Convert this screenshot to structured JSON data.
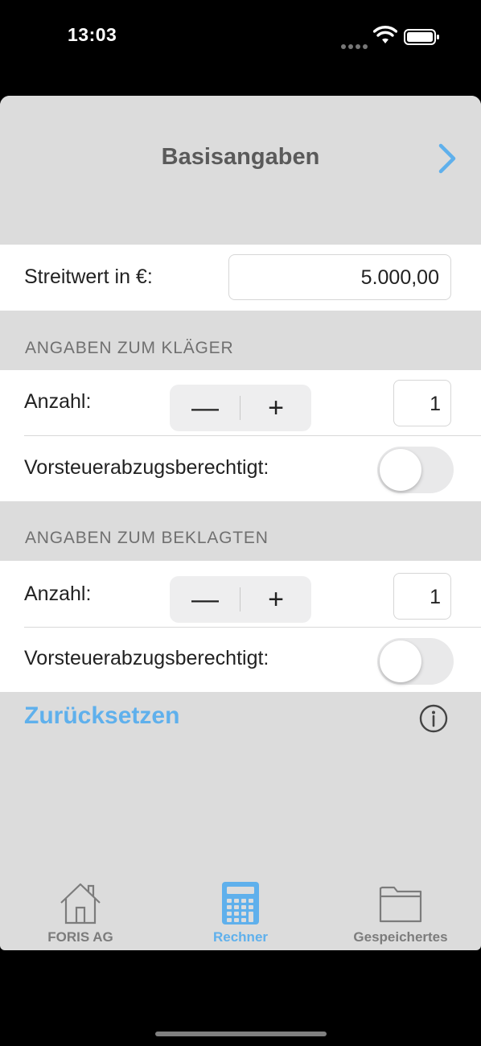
{
  "status_bar": {
    "time": "13:03"
  },
  "nav": {
    "title": "Basisangaben"
  },
  "streitwert": {
    "label": "Streitwert in €:",
    "value": "5.000,00"
  },
  "klaeger": {
    "header": "ANGABEN ZUM KLÄGER",
    "anzahl_label": "Anzahl:",
    "anzahl_value": "1",
    "stepper_minus": "—",
    "stepper_plus": "+",
    "vorsteuer_label": "Vorsteuerabzugsberechtigt:",
    "vorsteuer_on": false
  },
  "beklagte": {
    "header": "ANGABEN ZUM BEKLAGTEN",
    "anzahl_label": "Anzahl:",
    "anzahl_value": "1",
    "stepper_minus": "—",
    "stepper_plus": "+",
    "vorsteuer_label": "Vorsteuerabzugsberechtigt:",
    "vorsteuer_on": false
  },
  "reset_label": "Zurücksetzen",
  "tabs": [
    {
      "label": "FORIS AG",
      "icon": "house-icon",
      "active": false
    },
    {
      "label": "Rechner",
      "icon": "calculator-icon",
      "active": true
    },
    {
      "label": "Gespeichertes",
      "icon": "folder-icon",
      "active": false
    }
  ],
  "colors": {
    "accent": "#5fb0ec",
    "background": "#dcdcdc"
  }
}
